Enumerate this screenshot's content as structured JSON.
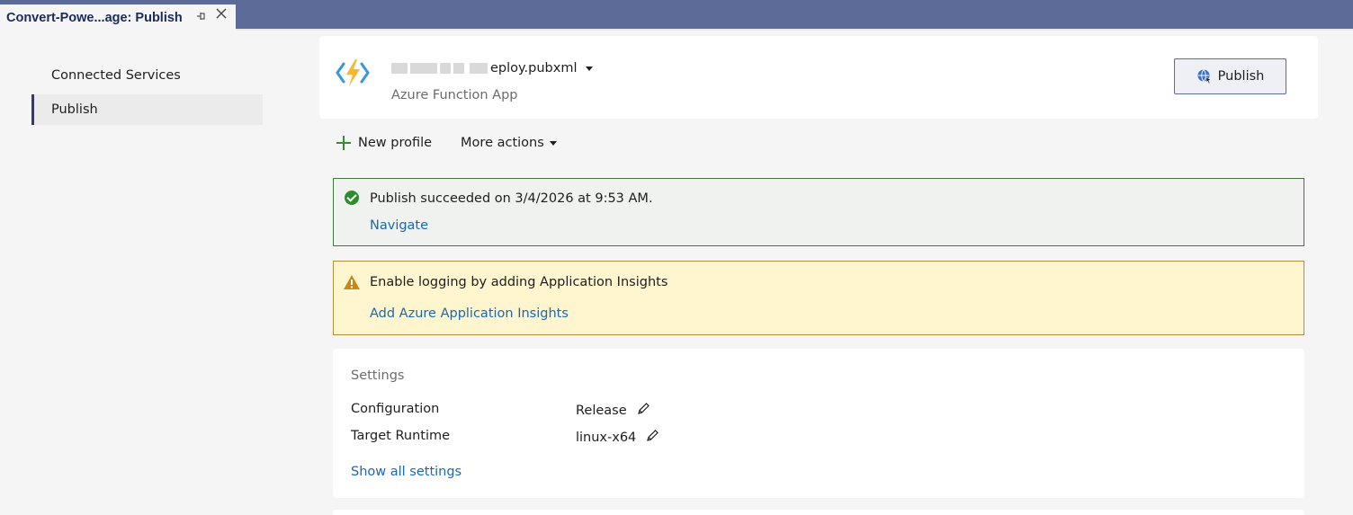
{
  "doc_tab": {
    "title": "Convert-Powe...age: Publish",
    "pin_icon": "pin-icon",
    "close_icon": "close-icon"
  },
  "nav": {
    "items": [
      {
        "label": "Connected Services"
      },
      {
        "label": "Publish"
      }
    ]
  },
  "profile": {
    "name_visible": "eploy.pubxml",
    "type": "Azure Function App",
    "icon": "azure-function-icon",
    "publish_label": "Publish"
  },
  "actions": {
    "new_profile": "New profile",
    "more_actions": "More actions"
  },
  "success_banner": {
    "message": "Publish succeeded on 3/4/2026 at 9:53 AM.",
    "link": "Navigate"
  },
  "warning_banner": {
    "message": "Enable logging by adding Application Insights",
    "link": "Add Azure Application Insights"
  },
  "settings": {
    "heading": "Settings",
    "rows": [
      {
        "label": "Configuration",
        "value": "Release"
      },
      {
        "label": "Target Runtime",
        "value": "linux-x64"
      }
    ],
    "show_all": "Show all settings"
  },
  "colors": {
    "titlebar": "#5d6b99",
    "success_border": "#3a7d3a",
    "warning_bg": "#fff5cf",
    "link": "#1a67b4"
  }
}
